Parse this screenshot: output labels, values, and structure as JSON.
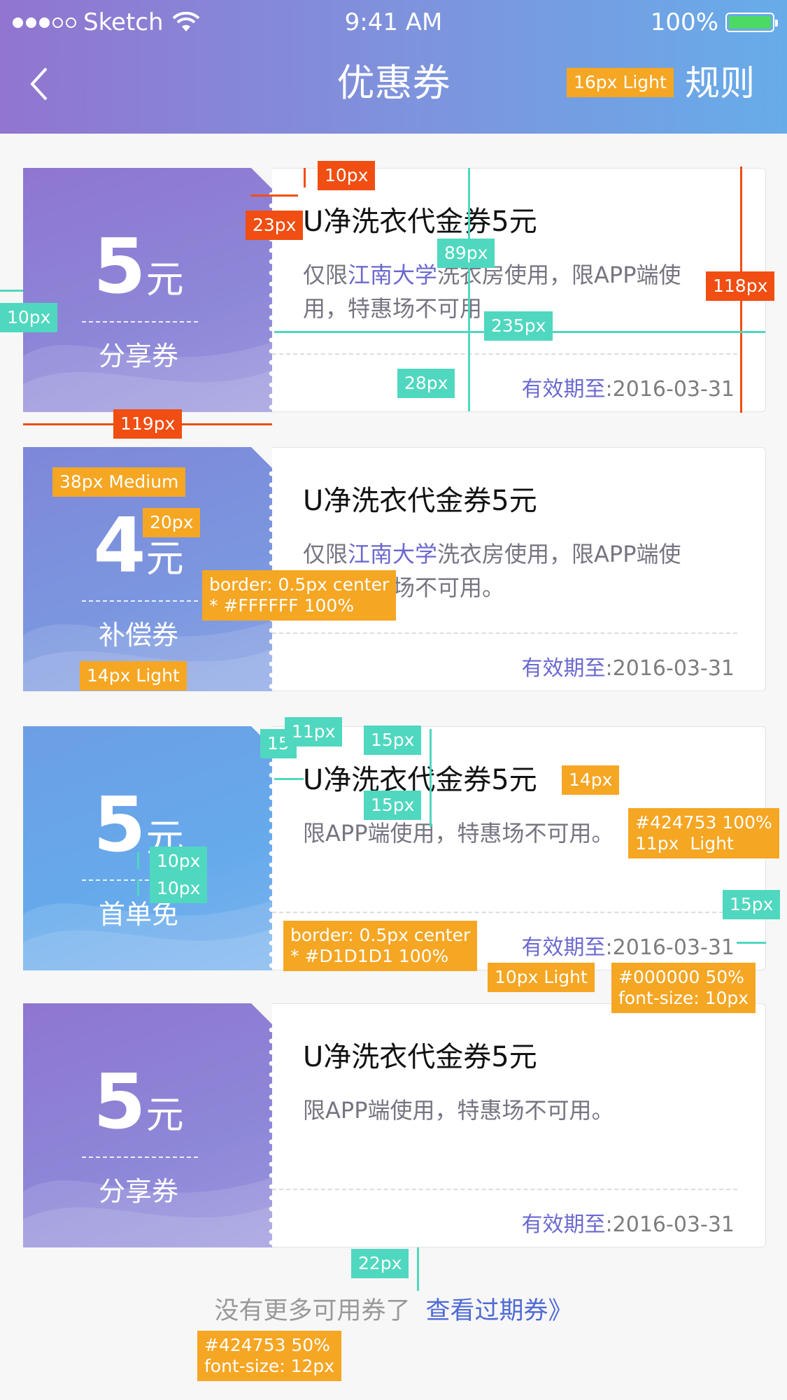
{
  "status_bar": {
    "carrier": "Sketch",
    "time": "9:41 AM",
    "battery": "100%"
  },
  "nav": {
    "title": "优惠券",
    "rules": "规则"
  },
  "coupons": [
    {
      "amount": "5",
      "unit": "元",
      "type": "分享券",
      "title": "U净洗衣代金券5元",
      "desc_pre": "仅限",
      "desc_hl": "江南大学",
      "desc_post": "洗衣房使用，限APP端使用，特惠场不可用",
      "expiry_label": "有效期至",
      "expiry_sep": ":",
      "expiry_date": "2016-03-31"
    },
    {
      "amount": "4",
      "unit": "元",
      "type": "补偿券",
      "title": "U净洗衣代金券5元",
      "desc_pre": "仅限",
      "desc_hl": "江南大学",
      "desc_post": "洗衣房使用，限APP端使用，特惠场不可用。",
      "expiry_label": "有效期至",
      "expiry_sep": ":",
      "expiry_date": "2016-03-31"
    },
    {
      "amount": "5",
      "unit": "元",
      "type": "首单免",
      "title": "U净洗衣代金券5元",
      "desc_pre": "",
      "desc_hl": "",
      "desc_post": "限APP端使用，特惠场不可用。",
      "expiry_label": "有效期至",
      "expiry_sep": ":",
      "expiry_date": "2016-03-31"
    },
    {
      "amount": "5",
      "unit": "元",
      "type": "分享券",
      "title": "U净洗衣代金券5元",
      "desc_pre": "",
      "desc_hl": "",
      "desc_post": "限APP端使用，特惠场不可用。",
      "expiry_label": "有效期至",
      "expiry_sep": ":",
      "expiry_date": "2016-03-31"
    }
  ],
  "footer": {
    "no_more": "没有更多可用券了",
    "view_expired": "查看过期券》"
  },
  "annotations": {
    "nav_font": "16px  Light",
    "top_10": "10px",
    "left_23": "23px",
    "right_89": "89px",
    "height_118": "118px",
    "outer_10": "10px",
    "width_235": "235px",
    "expiry_28": "28px",
    "left_119": "119px",
    "amount_font": "38px  Medium",
    "unit_font": "20px",
    "white_border": "border: 0.5px center\n* #FFFFFF 100%",
    "type_font": "14px  Light",
    "pad_15a": "15",
    "pad_11": "11px",
    "pad_15b": "15px",
    "pad_14": "14px",
    "pad_15c": "15px",
    "desc_color": "#424753 100%\n11px  Light",
    "gap_10a": "10px",
    "gap_10b": "10px",
    "grey_border": "border: 0.5px center\n* #D1D1D1 100%",
    "right_15": "15px",
    "exp_label_font": "10px  Light",
    "exp_date_color": "#000000 50%\nfont-size: 10px",
    "footer_22": "22px",
    "footer_color": "#424753 50%\nfont-size: 12px"
  },
  "colors": {
    "header_start": "#9175cf",
    "header_end": "#67ace9",
    "highlight": "#6b69d0",
    "link": "#4f6ad4",
    "tag_orange": "#f5a623",
    "tag_red": "#f04e12",
    "tag_green": "#4fd8bf"
  }
}
